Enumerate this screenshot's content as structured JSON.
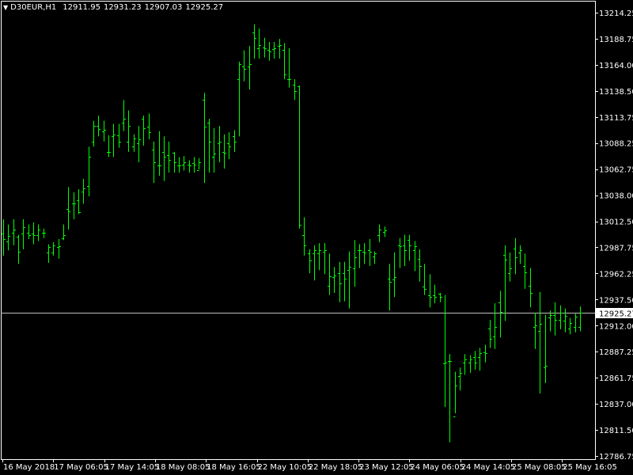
{
  "header": {
    "symbol": "D30EUR,H1",
    "open": "12911.95",
    "high": "12931.23",
    "low": "12907.03",
    "close": "12925.27"
  },
  "colors": {
    "background": "#000000",
    "bar": "#00ff00",
    "axis": "#ffffff",
    "price_line": "#c0c0c0"
  },
  "chart_data": {
    "type": "ohlc",
    "ylim": [
      12786.75,
      13214.25
    ],
    "y_ticks": [
      "13214.25",
      "13188.75",
      "13164.00",
      "13138.50",
      "13113.75",
      "13088.25",
      "13062.75",
      "13038.00",
      "13012.50",
      "12987.75",
      "12962.25",
      "12937.50",
      "12912.00",
      "12887.25",
      "12861.75",
      "12837.00",
      "12811.50",
      "12786.75"
    ],
    "x_labels": [
      "16 May 2018",
      "17 May 06:05",
      "17 May 14:05",
      "18 May 08:05",
      "18 May 16:05",
      "22 May 10:05",
      "22 May 18:05",
      "23 May 12:05",
      "24 May 06:05",
      "24 May 14:05",
      "25 May 08:05",
      "25 May 16:05"
    ],
    "current_price": "12925.27",
    "bars": [
      [
        13001,
        13015,
        12980,
        12996
      ],
      [
        12994,
        13010,
        12985,
        12999
      ],
      [
        13002,
        13015,
        12990,
        13005
      ],
      [
        12998,
        13000,
        12972,
        12984
      ],
      [
        13001,
        13015,
        12986,
        13007
      ],
      [
        13002,
        13010,
        12996,
        13000
      ],
      [
        13001,
        13012,
        12991,
        13000
      ],
      [
        13000,
        13010,
        12994,
        13005
      ],
      [
        13002,
        13006,
        12997,
        13002
      ],
      [
        12983,
        12991,
        12973,
        12988
      ],
      [
        12983,
        12993,
        12980,
        12990
      ],
      [
        12988,
        12996,
        12977,
        12989
      ],
      [
        12997,
        13010,
        12995,
        13000
      ],
      [
        13025,
        13046,
        13005,
        13023
      ],
      [
        13030,
        13041,
        13015,
        13030
      ],
      [
        13033,
        13044,
        13020,
        13022
      ],
      [
        13042,
        13054,
        13030,
        13045
      ],
      [
        13047,
        13085,
        13037,
        13075
      ],
      [
        13090,
        13110,
        13085,
        13105
      ],
      [
        13105,
        13115,
        13095,
        13102
      ],
      [
        13100,
        13110,
        13090,
        13101
      ],
      [
        13080,
        13096,
        13075,
        13080
      ],
      [
        13095,
        13107,
        13075,
        13097
      ],
      [
        13096,
        13107,
        13084,
        13090
      ],
      [
        13108,
        13130,
        13100,
        13112
      ],
      [
        13090,
        13120,
        13080,
        13105
      ],
      [
        13085,
        13097,
        13080,
        13093
      ],
      [
        13088,
        13105,
        13070,
        13092
      ],
      [
        13112,
        13115,
        13086,
        13103
      ],
      [
        13104,
        13117,
        13092,
        13099
      ],
      [
        13082,
        13090,
        13050,
        13070
      ],
      [
        13067,
        13100,
        13057,
        13067
      ],
      [
        13080,
        13095,
        13052,
        13075
      ],
      [
        13077,
        13090,
        13060,
        13072
      ],
      [
        13079,
        13080,
        13060,
        13070
      ],
      [
        13067,
        13075,
        13060,
        13067
      ],
      [
        13068,
        13076,
        13062,
        13070
      ],
      [
        13068,
        13072,
        13060,
        13067
      ],
      [
        13069,
        13075,
        13060,
        13068
      ],
      [
        13062,
        13074,
        13063,
        13070
      ],
      [
        13130,
        13137,
        13050,
        13104
      ],
      [
        13108,
        13112,
        13060,
        13090
      ],
      [
        13075,
        13103,
        13060,
        13078
      ],
      [
        13088,
        13105,
        13070,
        13090
      ],
      [
        13080,
        13097,
        13064,
        13079
      ],
      [
        13088,
        13099,
        13073,
        13085
      ],
      [
        13095,
        13101,
        13080,
        13090
      ],
      [
        13150,
        13167,
        13095,
        13165
      ],
      [
        13162,
        13178,
        13148,
        13160
      ],
      [
        13162,
        13182,
        13140,
        13165
      ],
      [
        13195,
        13203,
        13170,
        13190
      ],
      [
        13180,
        13199,
        13170,
        13183
      ],
      [
        13181,
        13190,
        13171,
        13180
      ],
      [
        13178,
        13186,
        13168,
        13177
      ],
      [
        13179,
        13186,
        13170,
        13180
      ],
      [
        13182,
        13189,
        13170,
        13183
      ],
      [
        13178,
        13185,
        13150,
        13155
      ],
      [
        13150,
        13180,
        13142,
        13150
      ],
      [
        13145,
        13150,
        13130,
        13139
      ],
      [
        13143,
        13144,
        13006,
        13010
      ],
      [
        13000,
        13017,
        12980,
        12990
      ],
      [
        12982,
        12986,
        12963,
        12975
      ],
      [
        12982,
        12990,
        12956,
        12985
      ],
      [
        12982,
        12992,
        12966,
        12985
      ],
      [
        12984,
        12992,
        12962,
        12985
      ],
      [
        12951,
        12982,
        12942,
        12960
      ],
      [
        12959,
        12969,
        12944,
        12961
      ],
      [
        12963,
        12974,
        12935,
        12953
      ],
      [
        12963,
        12974,
        12936,
        12958
      ],
      [
        12966,
        12984,
        12929,
        12969
      ],
      [
        12968,
        12995,
        12950,
        12978
      ],
      [
        12985,
        12991,
        12968,
        12985
      ],
      [
        12984,
        12992,
        12972,
        12983
      ],
      [
        12985,
        12996,
        12970,
        12984
      ],
      [
        12979,
        12984,
        12972,
        12982
      ],
      [
        13000,
        13010,
        12993,
        13005
      ],
      [
        13003,
        13008,
        12998,
        13004
      ],
      [
        12958,
        12972,
        12927,
        12955
      ],
      [
        12957,
        12983,
        12940,
        12959
      ],
      [
        12990,
        12997,
        12968,
        12989
      ],
      [
        12990,
        13000,
        12970,
        12985
      ],
      [
        12995,
        13000,
        12975,
        12990
      ],
      [
        12985,
        12994,
        12965,
        12989
      ],
      [
        12977,
        12986,
        12955,
        12970
      ],
      [
        12950,
        12972,
        12942,
        12948
      ],
      [
        12942,
        12962,
        12930,
        12940
      ],
      [
        12942,
        12952,
        12934,
        12940
      ],
      [
        12943,
        12944,
        12935,
        12940
      ],
      [
        12876,
        12942,
        12834,
        12877
      ],
      [
        12878,
        12885,
        12800,
        12878
      ],
      [
        12825,
        12868,
        12828,
        12855
      ],
      [
        12864,
        12872,
        12850,
        12867
      ],
      [
        12877,
        12885,
        12865,
        12880
      ],
      [
        12877,
        12884,
        12867,
        12880
      ],
      [
        12882,
        12888,
        12870,
        12877
      ],
      [
        12882,
        12891,
        12869,
        12886
      ],
      [
        12887,
        12894,
        12877,
        12886
      ],
      [
        12910,
        12918,
        12891,
        12900
      ],
      [
        12902,
        12934,
        12890,
        12911
      ],
      [
        12935,
        12946,
        12901,
        12926
      ],
      [
        12981,
        12990,
        12917,
        12976
      ],
      [
        12963,
        12983,
        12955,
        12968
      ],
      [
        12987,
        12997,
        12962,
        12978
      ],
      [
        12983,
        12990,
        12972,
        12985
      ],
      [
        12970,
        12982,
        12948,
        12964
      ],
      [
        12951,
        12968,
        12930,
        12944
      ],
      [
        12911,
        12925,
        12890,
        12913
      ],
      [
        12907,
        12945,
        12847,
        12914
      ],
      [
        12872,
        12923,
        12857,
        12874
      ],
      [
        12920,
        12927,
        12907,
        12923
      ],
      [
        12923,
        12935,
        12903,
        12918
      ],
      [
        12918,
        12932,
        12909,
        12925
      ],
      [
        12917,
        12929,
        12906,
        12922
      ],
      [
        12910,
        12920,
        12904,
        12915
      ],
      [
        12911,
        12924,
        12906,
        12921
      ],
      [
        12911,
        12931,
        12907,
        12925
      ]
    ]
  }
}
